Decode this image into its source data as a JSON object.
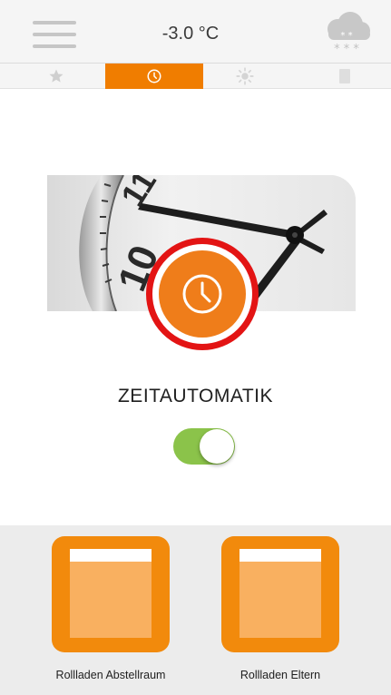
{
  "header": {
    "menu_icon": "hamburger-menu-icon",
    "temperature": "-3.0 °C",
    "weather_icon": "snow-cloud-icon"
  },
  "tabs": [
    {
      "icon": "star-icon",
      "active": false
    },
    {
      "icon": "clock-icon",
      "active": true
    },
    {
      "icon": "sun-icon",
      "active": false
    },
    {
      "icon": "document-icon",
      "active": false
    }
  ],
  "automation": {
    "title": "ZEITAUTOMATIK",
    "enabled": true,
    "badge_icon": "clock-icon"
  },
  "devices": [
    {
      "name": "Rollladen Abstellraum",
      "icon": "shutter-icon"
    },
    {
      "name": "Rollladen Eltern",
      "icon": "shutter-icon"
    }
  ],
  "colors": {
    "accent": "#f07d00",
    "toggle_on": "#8bc34a",
    "highlight_ring": "#e31414"
  }
}
